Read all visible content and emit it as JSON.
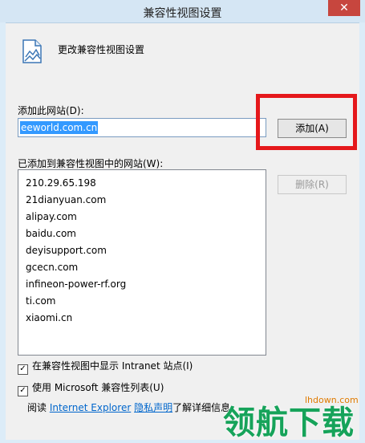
{
  "window": {
    "title": "兼容性视图设置",
    "close": "✕"
  },
  "header": {
    "text": "更改兼容性视图设置"
  },
  "add_section": {
    "label": "添加此网站(D):",
    "input_value": "eeworld.com.cn",
    "add_button": "添加(A)"
  },
  "list_section": {
    "label": "已添加到兼容性视图中的网站(W):",
    "remove_button": "删除(R)",
    "sites": [
      "210.29.65.198",
      "21dianyuan.com",
      "alipay.com",
      "baidu.com",
      "deyisupport.com",
      "gcecn.com",
      "infineon-power-rf.org",
      "ti.com",
      "xiaomi.cn"
    ]
  },
  "options": {
    "intranet": {
      "label": "在兼容性视图中显示 Intranet 站点(I)",
      "checked": true,
      "mark": "✓"
    },
    "microsoft_list": {
      "label": "使用 Microsoft 兼容性列表(U)",
      "checked": true,
      "mark": "✓"
    }
  },
  "footer": {
    "prefix": "阅读 ",
    "link1": "Internet Explorer",
    "link2": "隐私声明",
    "suffix": "了解详细信息"
  },
  "watermark": {
    "url": "lhdown.com",
    "text": "领航下载"
  },
  "colors": {
    "highlight": "#e5181b",
    "selection": "#3399ff",
    "link": "#0066cc",
    "close": "#c7463e"
  }
}
